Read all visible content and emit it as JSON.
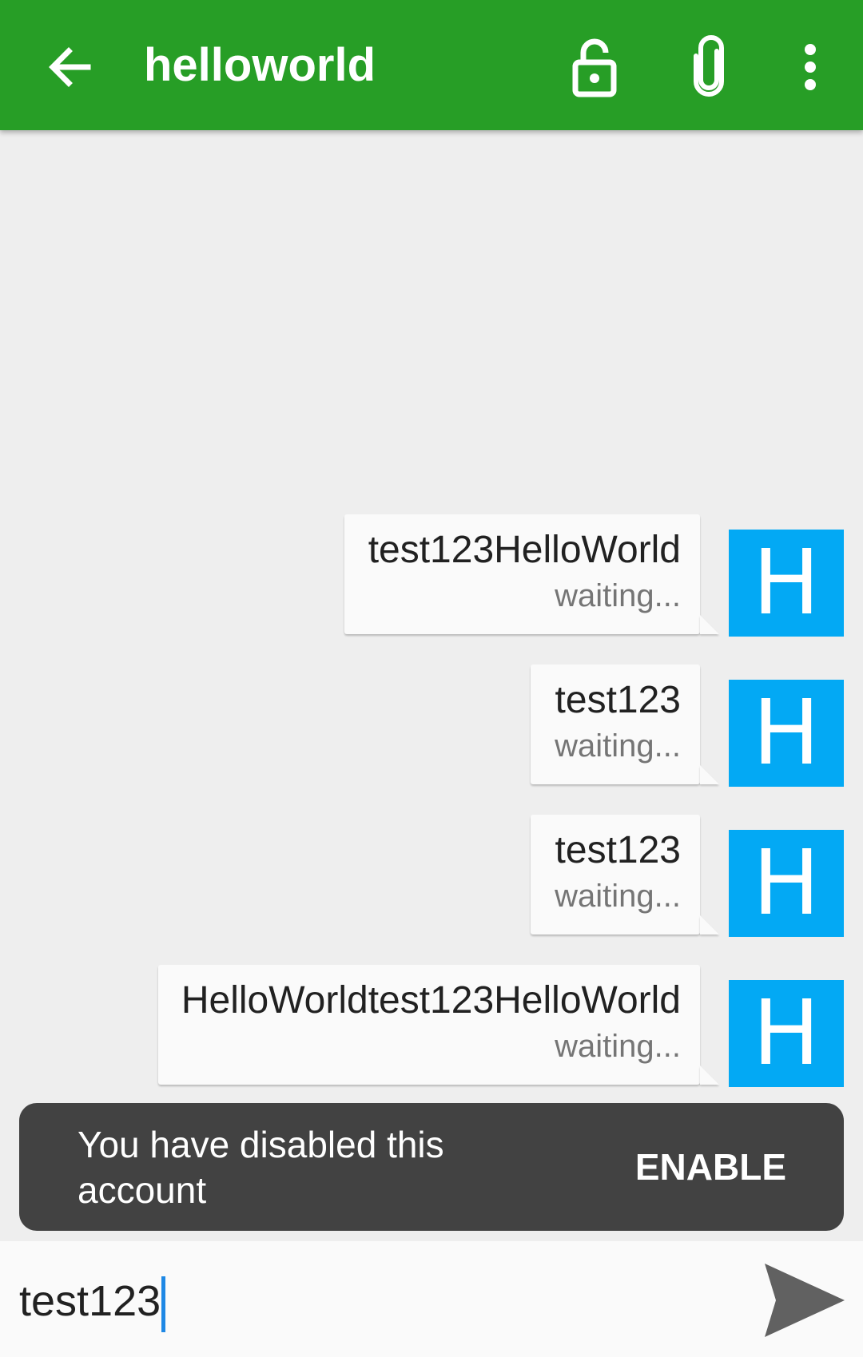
{
  "appbar": {
    "title": "helloworld",
    "back_icon": "arrow-back-icon",
    "actions": [
      "lock-open-icon",
      "attachment-icon",
      "more-vert-icon"
    ]
  },
  "colors": {
    "appbar": "#279e26",
    "avatar": "#03a9f4",
    "snackbar": "#424242",
    "caret": "#1e88e5"
  },
  "messages": [
    {
      "text": "test123HelloWorld",
      "status": "waiting...",
      "avatar_letter": "H"
    },
    {
      "text": "test123",
      "status": "waiting...",
      "avatar_letter": "H"
    },
    {
      "text": "test123",
      "status": "waiting...",
      "avatar_letter": "H"
    },
    {
      "text": "HelloWorldtest123HelloWorld",
      "status": "waiting...",
      "avatar_letter": "H"
    }
  ],
  "snackbar": {
    "message": "You have disabled this account",
    "action": "ENABLE"
  },
  "compose": {
    "value": "test123",
    "send_icon": "send-icon"
  }
}
